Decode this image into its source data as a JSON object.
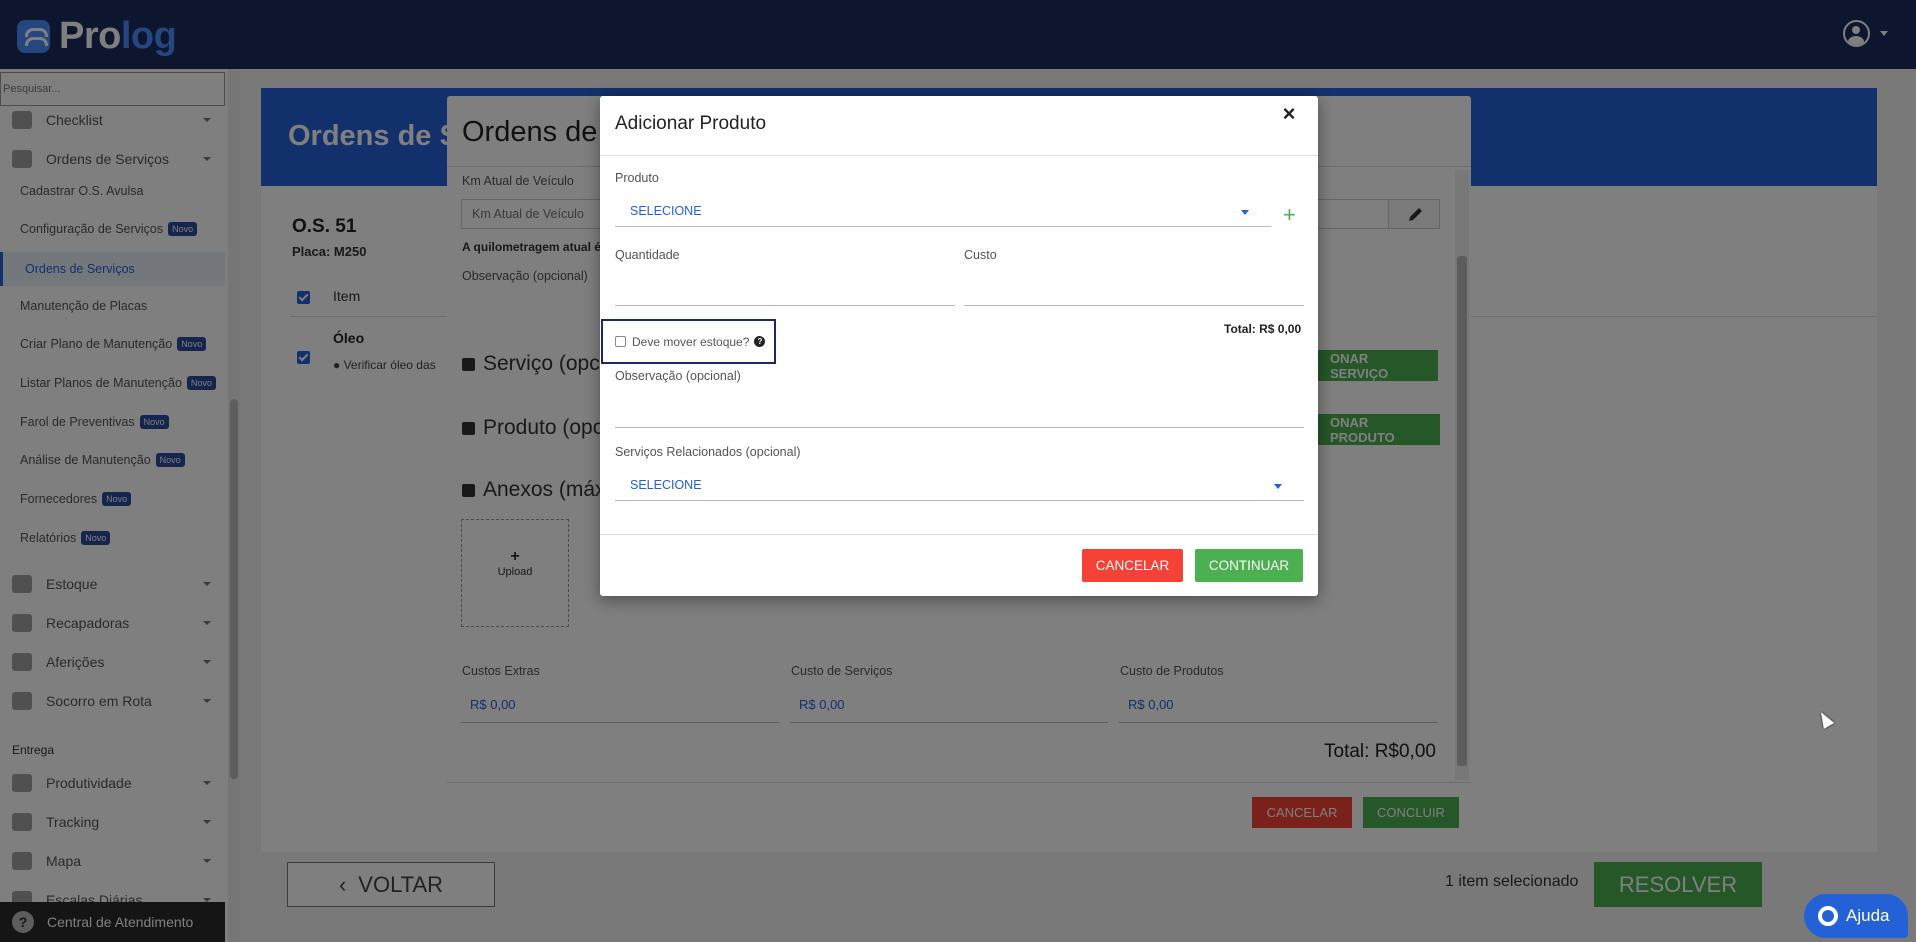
{
  "app": {
    "logo_pro": "Pro",
    "logo_log": "log"
  },
  "sidebar": {
    "search_placeholder": "Pesquisar...",
    "items": [
      {
        "label": "Checklist"
      },
      {
        "label": "Ordens de Serviços"
      }
    ],
    "subitems": [
      {
        "label": "Cadastrar O.S. Avulsa",
        "badge": ""
      },
      {
        "label": "Configuração de Serviços",
        "badge": "Novo"
      },
      {
        "label": "Ordens de Serviços",
        "badge": ""
      },
      {
        "label": "Manutenção de Placas",
        "badge": ""
      },
      {
        "label": "Criar Plano de Manutenção",
        "badge": "Novo"
      },
      {
        "label": "Listar Planos de Manutenção",
        "badge": "Novo"
      },
      {
        "label": "Farol de Preventivas",
        "badge": "Novo"
      },
      {
        "label": "Análise de Manutenção",
        "badge": "Novo"
      },
      {
        "label": "Fornecedores",
        "badge": "Novo"
      },
      {
        "label": "Relatórios",
        "badge": "Novo"
      }
    ],
    "groups": [
      {
        "label": "Estoque"
      },
      {
        "label": "Recapadoras"
      },
      {
        "label": "Aferições"
      },
      {
        "label": "Socorro em Rota"
      }
    ],
    "section_entrega": "Entrega",
    "entrega_items": [
      {
        "label": "Produtividade"
      },
      {
        "label": "Tracking"
      },
      {
        "label": "Mapa"
      },
      {
        "label": "Escalas Diárias"
      }
    ],
    "help_label": "Central de Atendimento"
  },
  "page": {
    "title": "Ordens de Se",
    "os_title": "O.S. 51",
    "plate": "Placa: M250",
    "item_header": "Item",
    "item_name": "Óleo",
    "item_desc": "● Verificar óleo das",
    "back_label": "VOLTAR",
    "selected_count": "1 item selecionado",
    "resolve_label": "RESOLVER"
  },
  "outer_modal": {
    "title": "Ordens de S",
    "km_label": "Km Atual de Veículo",
    "km_placeholder": "Km Atual de Veículo",
    "km_note": "A quilometragem atual é",
    "obs_label": "Observação (opcional)",
    "service_section": "Serviço (opci",
    "product_section": "Produto (opci",
    "attachments_section": "Anexos (máx.",
    "add_service_btn": "ONAR SERVIÇO",
    "add_product_btn": "ONAR PRODUTO",
    "upload_plus": "+",
    "upload_label": "Upload",
    "costs": [
      {
        "label": "Custos Extras",
        "value": "R$ 0,00"
      },
      {
        "label": "Custo de Serviços",
        "value": "R$ 0,00"
      },
      {
        "label": "Custo de Produtos",
        "value": "R$ 0,00"
      }
    ],
    "total": "Total: R$0,00",
    "cancel_label": "CANCELAR",
    "confirm_label": "CONCLUIR"
  },
  "modal": {
    "title": "Adicionar Produto",
    "close_glyph": "×",
    "product_label": "Produto",
    "product_value": "SELECIONE",
    "add_glyph": "+",
    "quantity_label": "Quantidade",
    "quantity_value": "",
    "cost_label": "Custo",
    "cost_value": "",
    "total_text": "Total: R$ 0,00",
    "stock_label": "Deve mover estoque?",
    "stock_checked": false,
    "help_glyph": "?",
    "observation_label": "Observação (opcional)",
    "observation_value": "",
    "related_services_label": "Serviços Relacionados (opcional)",
    "related_services_value": "SELECIONE",
    "cancel_label": "CANCELAR",
    "continue_label": "CONTINUAR"
  },
  "floating": {
    "help_label": "Ajuda"
  },
  "colors": {
    "topbar": "#1d2a5f",
    "accent": "#2461d6",
    "success": "#4caf50",
    "danger": "#f44336"
  }
}
